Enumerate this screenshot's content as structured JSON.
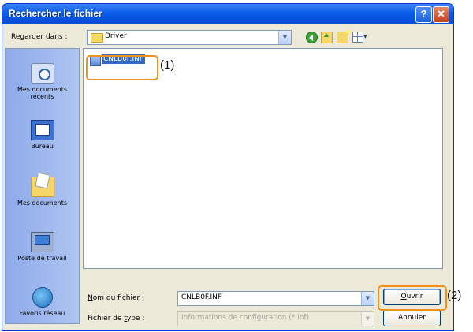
{
  "window": {
    "title": "Rechercher le fichier",
    "help_glyph": "?",
    "close_glyph": "✕"
  },
  "toolbar": {
    "lookin_label": "Regarder dans :",
    "lookin_value": "Driver",
    "icons": [
      "back-icon",
      "up-folder-icon",
      "new-folder-icon",
      "view-menu-icon"
    ]
  },
  "places": [
    {
      "label": "Mes documents récents",
      "icon": "recent-documents-icon"
    },
    {
      "label": "Bureau",
      "icon": "desktop-icon"
    },
    {
      "label": "Mes documents",
      "icon": "my-documents-icon"
    },
    {
      "label": "Poste de travail",
      "icon": "my-computer-icon"
    },
    {
      "label": "Favoris réseau",
      "icon": "network-icon"
    }
  ],
  "files": [
    {
      "name": "CNLB0F.INF",
      "selected": true
    }
  ],
  "form": {
    "filename_label": "Nom du fichier :",
    "filename_value": "CNLB0F.INF",
    "filetype_label": "Fichier de type :",
    "filetype_value": "Informations de configuration (*.inf)",
    "open_button": "Ouvrir",
    "cancel_button": "Annuler"
  },
  "callouts": {
    "one": "(1)",
    "two": "(2)"
  },
  "colors": {
    "titlebar": "#0a5ce8",
    "highlight": "#f0901e",
    "selection": "#316ac5"
  }
}
